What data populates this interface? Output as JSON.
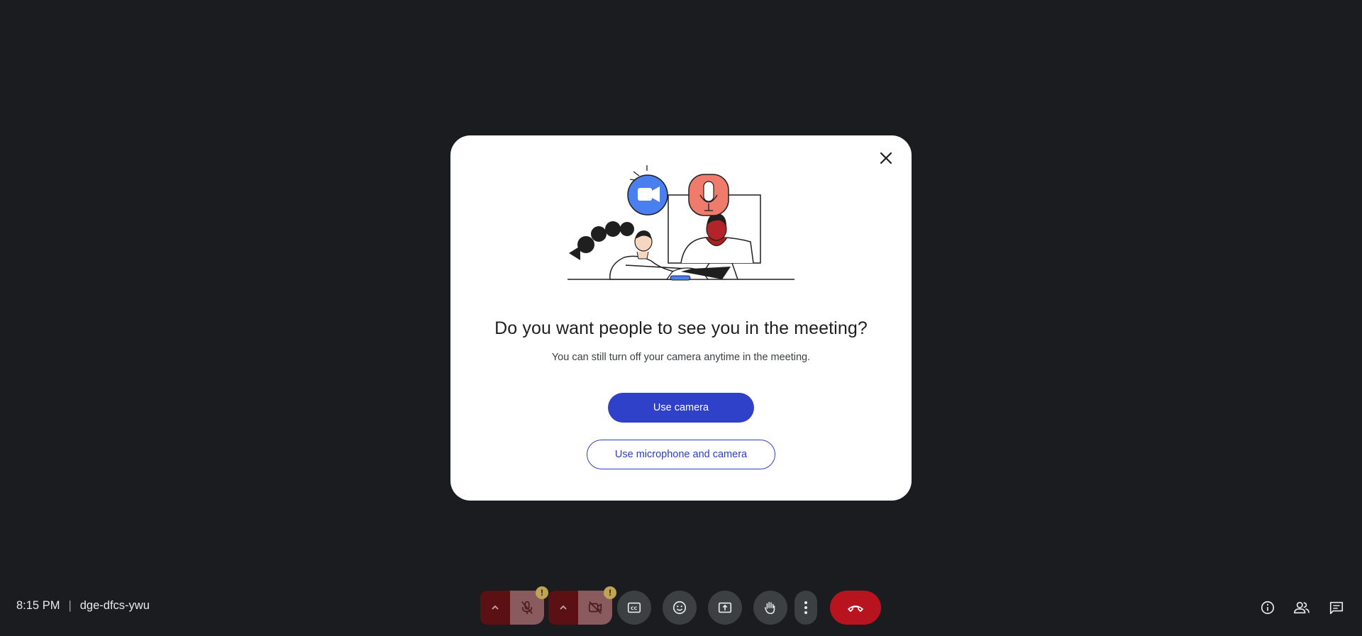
{
  "dialog": {
    "title": "Do you want people to see you in the meeting?",
    "subtitle": "You can still turn off your camera anytime in the meeting.",
    "primary_button": "Use camera",
    "secondary_button": "Use microphone and camera",
    "close_icon": "close-icon"
  },
  "meeting": {
    "time": "8:15 PM",
    "separator": "|",
    "code": "dge-dfcs-ywu"
  },
  "controls": {
    "mic_state": "off",
    "camera_state": "off",
    "warning_badge": "!",
    "icons": [
      "chevron-up-icon",
      "mic-off-icon",
      "camera-off-icon",
      "captions-icon",
      "emoji-icon",
      "present-icon",
      "raise-hand-icon",
      "more-vert-icon",
      "end-call-icon"
    ]
  },
  "right_panel": {
    "icons": [
      "info-icon",
      "people-icon",
      "chat-icon"
    ]
  },
  "colors": {
    "background": "#1b1c1f",
    "primary": "#3041c9",
    "end_call": "#b8141f",
    "warning": "#c0a451"
  }
}
